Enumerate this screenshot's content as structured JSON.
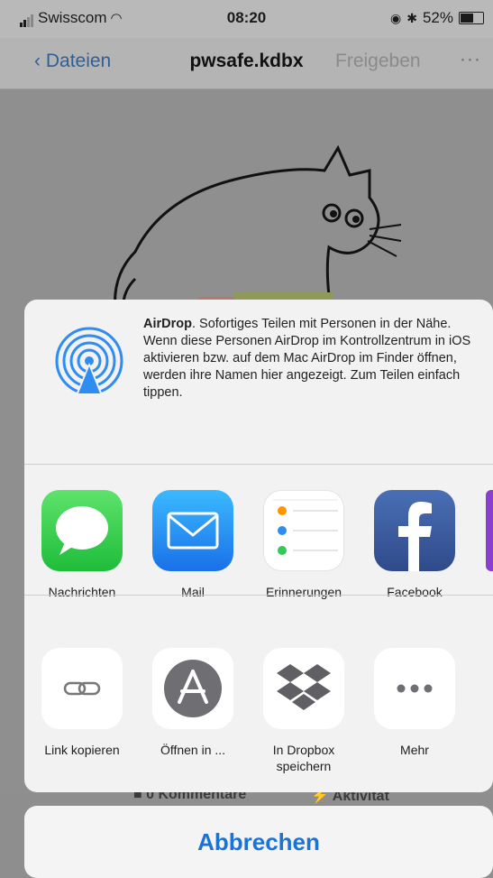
{
  "status": {
    "carrier": "Swisscom",
    "time": "08:20",
    "battery": "52%"
  },
  "nav": {
    "back": "Dateien",
    "title": "pwsafe.kdbx",
    "share": "Freigeben",
    "more": "···"
  },
  "bottom_bar": {
    "comments": "0 Kommentare",
    "activity": "Aktivität"
  },
  "airdrop": {
    "title": "AirDrop",
    "text": ". Sofortiges Teilen mit Personen in der Nähe. Wenn diese Personen AirDrop im Kontrollzentrum in iOS aktivieren bzw. auf dem Mac AirDrop im Finder öffnen, werden ihre Namen hier angezeigt. Zum Teilen einfach tippen."
  },
  "apps": [
    {
      "label": "Nachrichten",
      "icon": "messages-icon"
    },
    {
      "label": "Mail",
      "icon": "mail-icon"
    },
    {
      "label": "Erinnerungen",
      "icon": "reminders-icon"
    },
    {
      "label": "Facebook",
      "icon": "facebook-icon"
    }
  ],
  "actions": [
    {
      "label": "Link kopieren",
      "icon": "link-icon"
    },
    {
      "label": "Öffnen in ...",
      "icon": "app-store-icon"
    },
    {
      "label": "In Dropbox speichern",
      "icon": "dropbox-icon"
    },
    {
      "label": "Mehr",
      "icon": "more-icon"
    }
  ],
  "cancel": "Abbrechen",
  "colors": {
    "accent": "#1a73d8",
    "messages": "#34c759",
    "mail": "#1e8bf3",
    "facebook": "#3b5998"
  }
}
